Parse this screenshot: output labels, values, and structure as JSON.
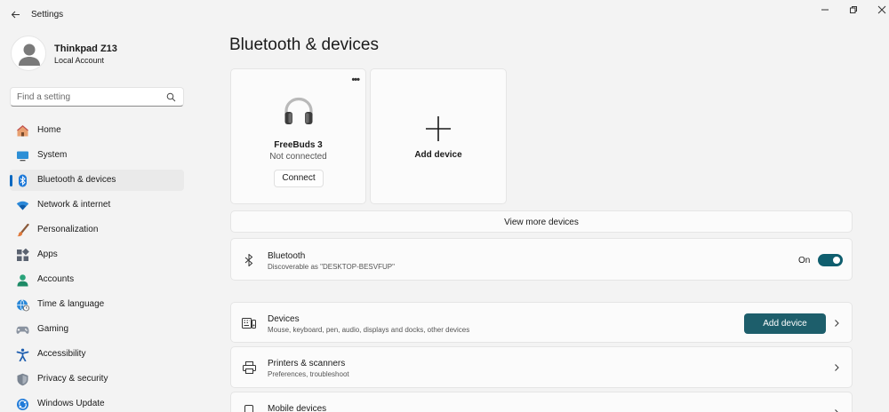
{
  "window": {
    "title": "Settings"
  },
  "profile": {
    "name": "Thinkpad Z13",
    "account_type": "Local Account"
  },
  "search": {
    "placeholder": "Find a setting"
  },
  "nav": {
    "selected": "Bluetooth & devices",
    "items": [
      {
        "label": "Home",
        "icon": "home-icon"
      },
      {
        "label": "System",
        "icon": "system-monitor-icon"
      },
      {
        "label": "Bluetooth & devices",
        "icon": "bluetooth-icon"
      },
      {
        "label": "Network & internet",
        "icon": "wifi-icon"
      },
      {
        "label": "Personalization",
        "icon": "paintbrush-icon"
      },
      {
        "label": "Apps",
        "icon": "apps-icon"
      },
      {
        "label": "Accounts",
        "icon": "person-icon"
      },
      {
        "label": "Time & language",
        "icon": "globe-clock-icon"
      },
      {
        "label": "Gaming",
        "icon": "gamepad-icon"
      },
      {
        "label": "Accessibility",
        "icon": "accessibility-icon"
      },
      {
        "label": "Privacy & security",
        "icon": "shield-icon"
      },
      {
        "label": "Windows Update",
        "icon": "update-icon"
      }
    ]
  },
  "main": {
    "title": "Bluetooth & devices",
    "device_card": {
      "name": "FreeBuds 3",
      "status": "Not connected",
      "connect_label": "Connect",
      "icon": "headphones-icon"
    },
    "add_card": {
      "label": "Add device"
    },
    "view_more_label": "View more devices",
    "bluetooth": {
      "title": "Bluetooth",
      "subtitle": "Discoverable as \"DESKTOP-BESVFUP\"",
      "toggle_label": "On",
      "enabled": true
    },
    "devices": {
      "title": "Devices",
      "subtitle": "Mouse, keyboard, pen, audio, displays and docks, other devices",
      "button_label": "Add device"
    },
    "printers": {
      "title": "Printers & scanners",
      "subtitle": "Preferences, troubleshoot"
    },
    "mobile": {
      "title": "Mobile devices"
    }
  },
  "colors": {
    "accent": "#1d5e6b",
    "selection_indicator": "#0067c0",
    "background": "#f3f3f3",
    "card": "#fbfbfb"
  }
}
